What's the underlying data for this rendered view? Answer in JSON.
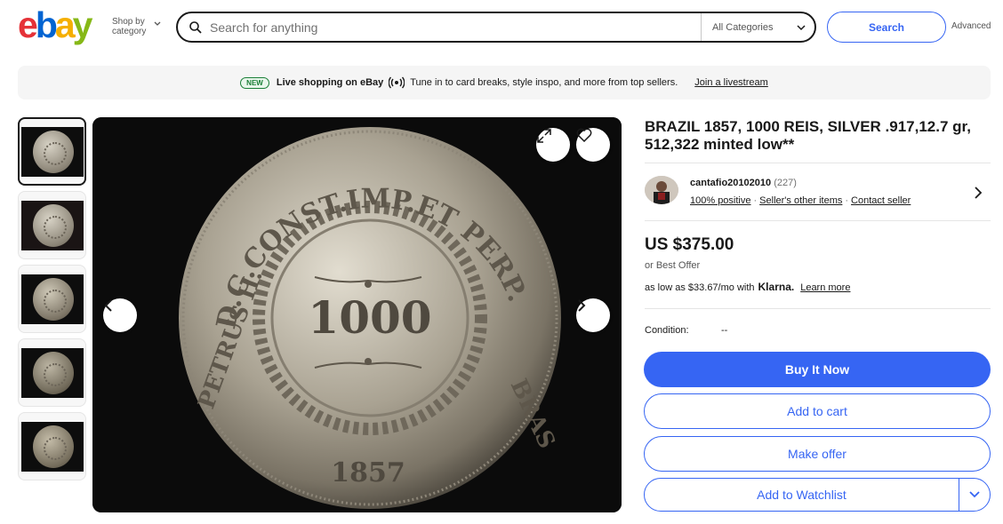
{
  "header": {
    "logo_letters": [
      {
        "char": "e",
        "color": "#e53238"
      },
      {
        "char": "b",
        "color": "#0064d2"
      },
      {
        "char": "a",
        "color": "#f5af02"
      },
      {
        "char": "y",
        "color": "#86b817"
      }
    ],
    "shop_by_line1": "Shop by",
    "shop_by_line2": "category",
    "search_placeholder": "Search for anything",
    "category_select": "All Categories",
    "search_button": "Search",
    "advanced_link": "Advanced"
  },
  "banner": {
    "badge": "NEW",
    "headline": "Live shopping on eBay",
    "description": "Tune in to card breaks, style inspo, and more from top sellers.",
    "link": "Join a livestream"
  },
  "gallery": {
    "thumbnail_count": 5,
    "active_thumbnail": 1,
    "coin_legend_top": "D.G.CONST.IMP.ET PERP.",
    "coin_legend_left": "PETRUS II.",
    "coin_legend_right": "BRAS",
    "coin_value": "1000",
    "coin_year": "1857"
  },
  "listing": {
    "title": "BRAZIL 1857, 1000 REIS, SILVER .917,12.7 gr, 512,322 minted low**",
    "seller": {
      "name": "cantafio20102010",
      "feedback_count": "(227)",
      "positive": "100% positive",
      "other_items": "Seller's other items",
      "contact": "Contact seller"
    },
    "price": "US $375.00",
    "best_offer": "or Best Offer",
    "klarna_prefix": "as low as $33.67/mo with",
    "klarna_brand": "Klarna.",
    "klarna_link": "Learn more",
    "condition_label": "Condition:",
    "condition_value": "--",
    "buy_now": "Buy It Now",
    "add_to_cart": "Add to cart",
    "make_offer": "Make offer",
    "add_to_watchlist": "Add to Watchlist"
  },
  "colors": {
    "accent_blue": "#3665f3",
    "new_green": "#1a7f37"
  }
}
